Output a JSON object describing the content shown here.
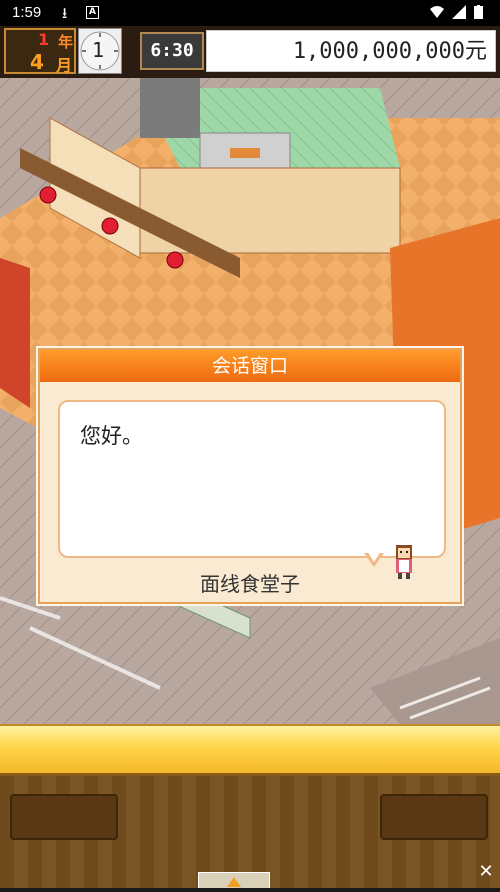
{
  "status_bar": {
    "time": "1:59",
    "download_glyph": "⭳",
    "a_glyph": "A"
  },
  "hud": {
    "year_num": "1",
    "year_unit": "年",
    "month_num": "4",
    "month_unit": "月",
    "day": "1",
    "time": "6:30",
    "money": "1,000,000,000元"
  },
  "dialog": {
    "title": "会话窗口",
    "message": "您好。",
    "speaker": "面线食堂子"
  },
  "bottom": {
    "close_glyph": "✕"
  },
  "colors": {
    "accent_orange": "#ee6a10",
    "bar_yellow": "#ffd54a"
  }
}
